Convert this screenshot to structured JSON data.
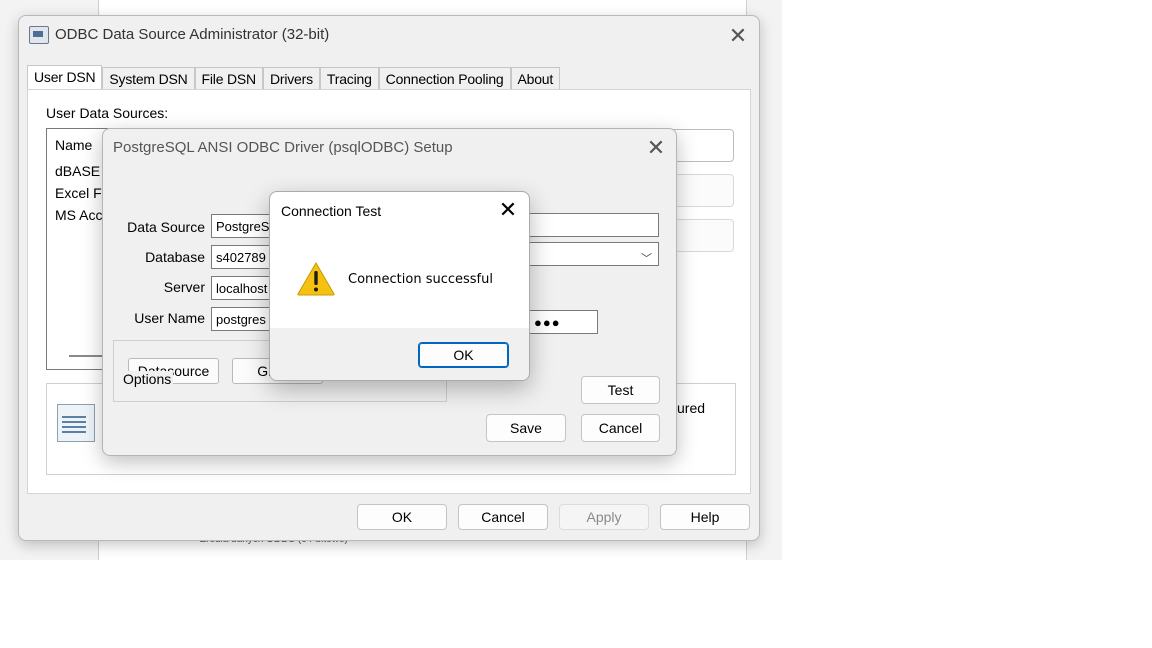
{
  "background": {
    "footer_text": "Źródła danych ODBC (64-bitowe)"
  },
  "admin": {
    "title": "ODBC Data Source Administrator (32-bit)",
    "close_glyph": "✕",
    "tabs": [
      "User DSN",
      "System DSN",
      "File DSN",
      "Drivers",
      "Tracing",
      "Connection Pooling",
      "About"
    ],
    "active_tab": "User DSN",
    "user_data_sources_label": "User Data Sources:",
    "list_header": "Name",
    "list_rows": [
      "dBASE Files",
      "Excel Files",
      "MS Access Database"
    ],
    "info_text_partial": "ured",
    "buttons": {
      "ok": "OK",
      "cancel": "Cancel",
      "apply": "Apply",
      "help": "Help"
    }
  },
  "setup": {
    "title": "PostgreSQL ANSI ODBC Driver (psqlODBC) Setup",
    "close_glyph": "✕",
    "fields": {
      "data_source_label": "Data Source",
      "data_source_value": "PostgreSQL30",
      "database_label": "Database",
      "database_value": "s402789",
      "server_label": "Server",
      "server_value": "localhost",
      "user_name_label": "User Name",
      "user_name_value": "postgres",
      "password_mask": "●●●"
    },
    "options_label": "Options",
    "datasource_button": "Datasource",
    "global_button": "Global",
    "test_button": "Test",
    "save_button": "Save",
    "cancel_button": "Cancel"
  },
  "msgbox": {
    "title": "Connection Test",
    "close_glyph": "✕",
    "icon": "warning-icon",
    "message": "Connection successful",
    "ok_button": "OK"
  }
}
